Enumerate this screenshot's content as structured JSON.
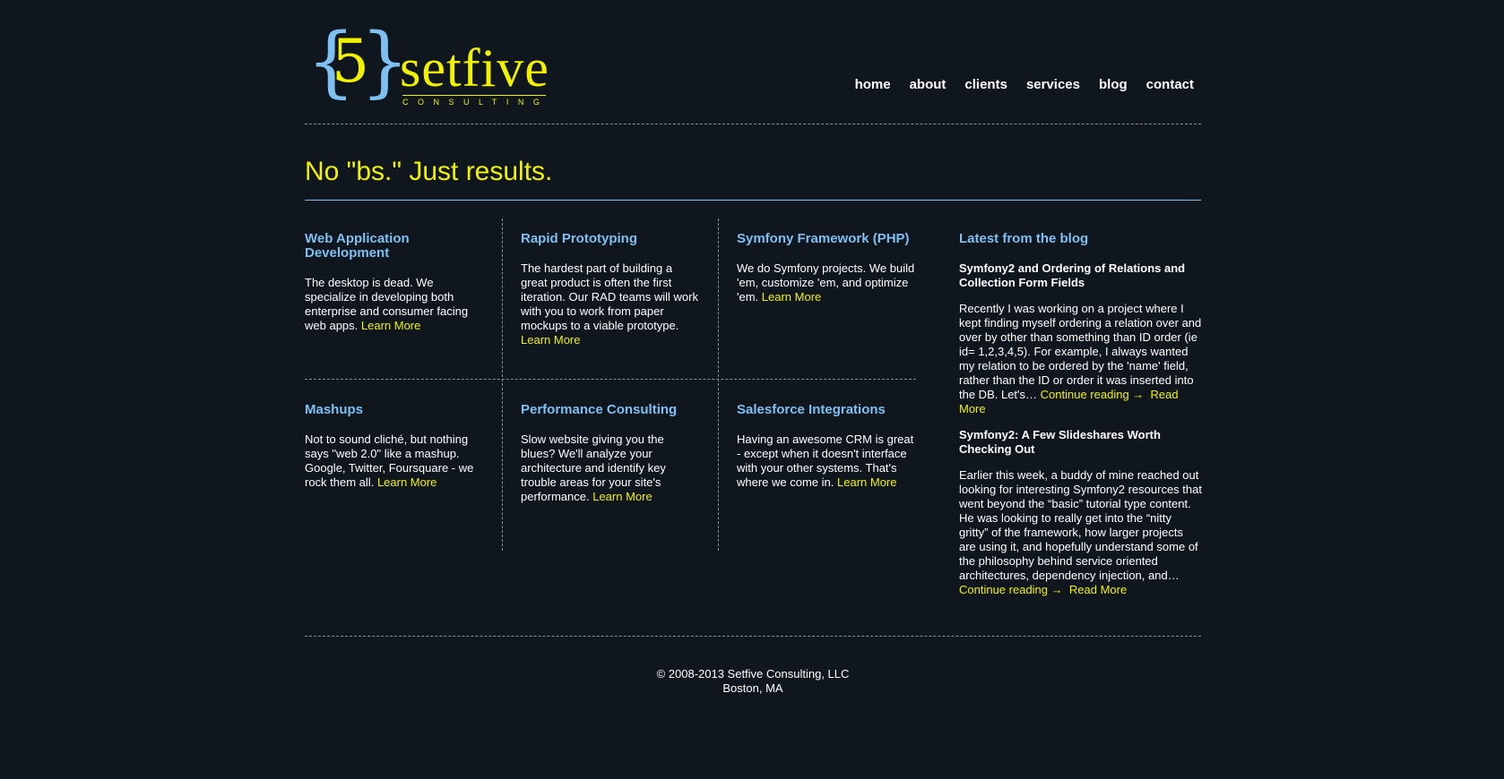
{
  "logo": {
    "brace_left": "{",
    "brace_right": "}",
    "digit": "5",
    "word": "setfive",
    "sub": "CONSULTING"
  },
  "nav": [
    {
      "label": "home"
    },
    {
      "label": "about"
    },
    {
      "label": "clients"
    },
    {
      "label": "services"
    },
    {
      "label": "blog"
    },
    {
      "label": "contact"
    }
  ],
  "tagline": "No \"bs.\" Just results.",
  "services": [
    {
      "title": "Web Application Development",
      "text": "The desktop is dead. We specialize in developing both enterprise and consumer facing web apps.",
      "link": "Learn More"
    },
    {
      "title": "Rapid Prototyping",
      "text": "The hardest part of building a great product is often the first iteration. Our RAD teams will work with you to work from paper mockups to a viable prototype.",
      "link": "Learn More"
    },
    {
      "title": "Symfony Framework (PHP)",
      "text": "We do Symfony projects. We build 'em, customize 'em, and optimize 'em.",
      "link": "Learn More"
    },
    {
      "title": "Mashups",
      "text": "Not to sound cliché, but nothing says \"web 2.0\" like a mashup. Google, Twitter, Foursquare - we rock them all.",
      "link": "Learn More"
    },
    {
      "title": "Performance Consulting",
      "text": "Slow website giving you the blues? We'll analyze your architecture and identify key trouble areas for your site's performance.",
      "link": "Learn More"
    },
    {
      "title": "Salesforce Integrations",
      "text": "Having an awesome CRM is great - except when it doesn't interface with your other systems. That's where we come in.",
      "link": "Learn More"
    }
  ],
  "blog": {
    "heading": "Latest from the blog",
    "posts": [
      {
        "title": "Symfony2 and Ordering of Relations and Collection Form Fields",
        "excerpt": "Recently I was working on a project where I kept finding myself ordering a relation over and over by other than something than ID order (ie id= 1,2,3,4,5). For example, I always wanted my relation to be ordered by the 'name' field, rather than the ID or order it was inserted into the DB. Let's…",
        "continue": "Continue reading →",
        "read_more": "Read More"
      },
      {
        "title": "Symfony2: A Few Slideshares Worth Checking Out",
        "excerpt": "Earlier this week, a buddy of mine reached out looking for interesting Symfony2 resources that went beyond the “basic” tutorial type content. He was looking to really get into the “nitty gritty” of the framework, how larger projects are using it, and hopefully understand some of the philosophy behind service oriented architectures, dependency injection, and…",
        "continue": "Continue reading →",
        "read_more": "Read More"
      }
    ]
  },
  "footer": {
    "copyright": "© 2008-2013 Setfive Consulting, LLC",
    "location": "Boston, MA"
  },
  "colors": {
    "background": "#0f161e",
    "accent_yellow": "#f2f200",
    "accent_blue": "#7ec0f2"
  }
}
